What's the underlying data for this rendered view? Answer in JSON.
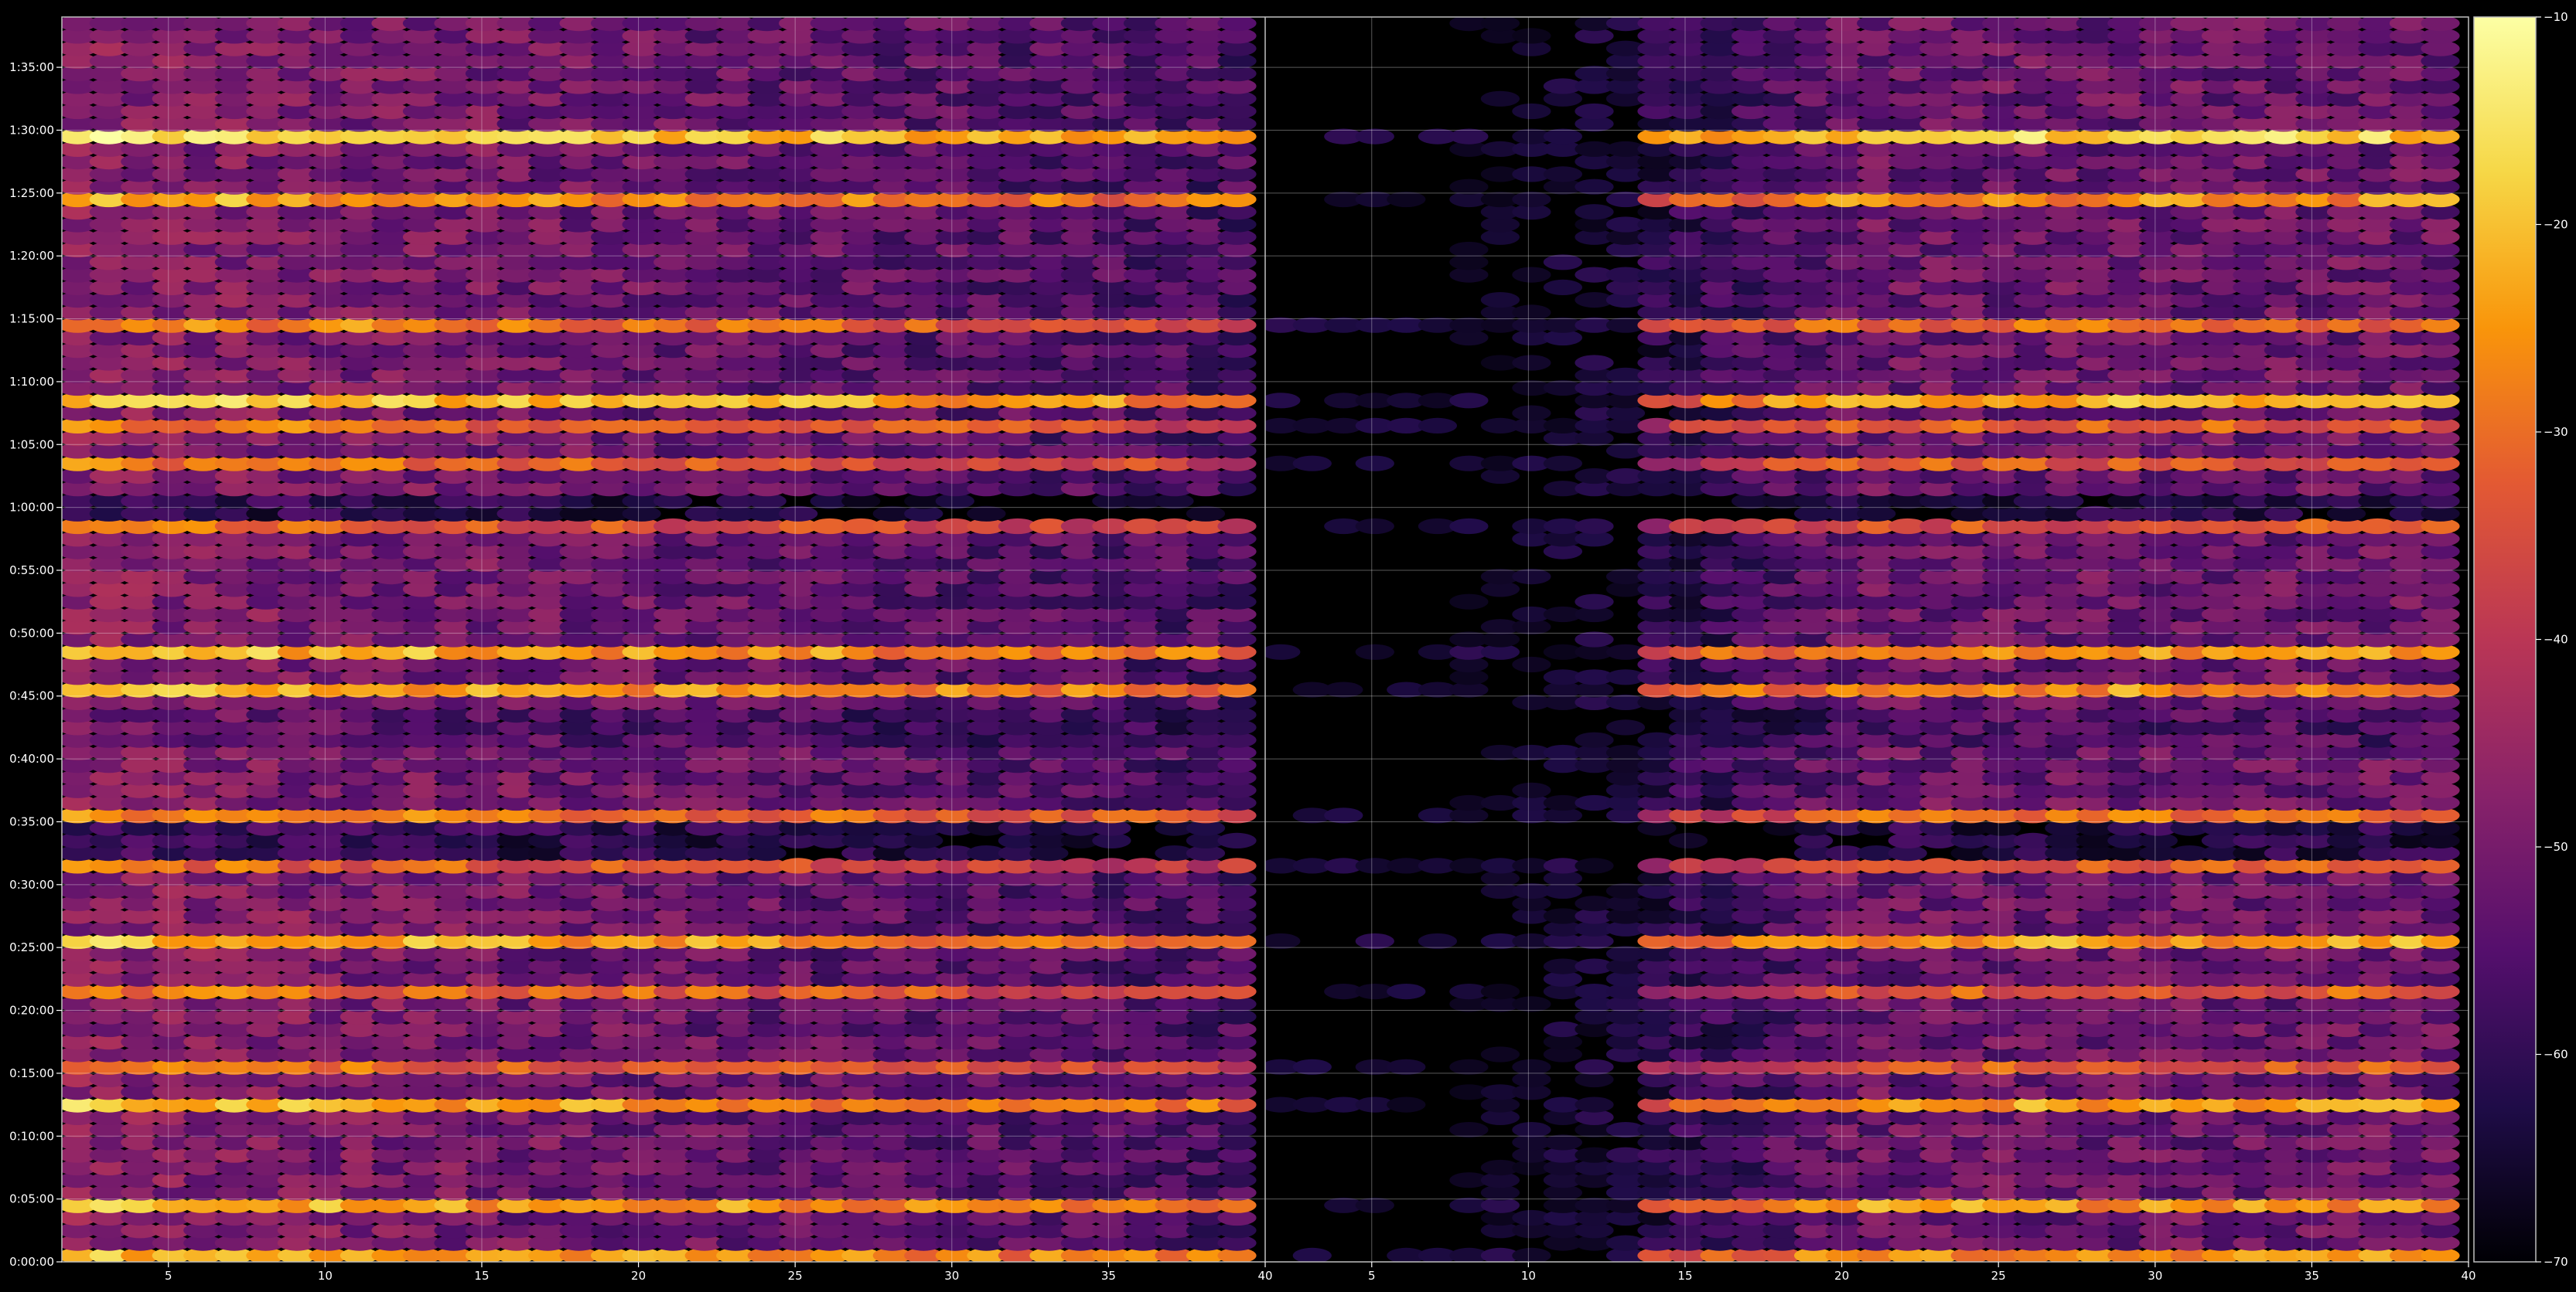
{
  "chart_data": {
    "type": "heatmap",
    "title": "",
    "xlabel": "",
    "ylabel": "",
    "colormap": "inferno",
    "background": "#000000",
    "foreground": "#ffffff",
    "grid": true,
    "panels": [
      {
        "name": "left",
        "xlim": [
          1.6,
          40
        ],
        "active_x_range": [
          1.6,
          39.6
        ],
        "xticks": [
          5,
          10,
          15,
          20,
          25,
          30,
          35,
          40
        ]
      },
      {
        "name": "right",
        "xlim": [
          1.6,
          40
        ],
        "active_x_range": [
          1.6,
          39.6
        ],
        "xticks": [
          5,
          10,
          15,
          20,
          25,
          30,
          35,
          40
        ]
      }
    ],
    "y": {
      "unit": "time",
      "range_seconds": [
        0,
        5940
      ],
      "tick_seconds": [
        0,
        300,
        600,
        900,
        1200,
        1500,
        1800,
        2100,
        2400,
        2700,
        3000,
        3300,
        3600,
        3900,
        4200,
        4500,
        4800,
        5100,
        5400,
        5700
      ],
      "tick_labels": [
        "0:00:00",
        "0:05:00",
        "0:10:00",
        "0:15:00",
        "0:20:00",
        "0:25:00",
        "0:30:00",
        "0:35:00",
        "0:40:00",
        "0:45:00",
        "0:50:00",
        "0:55:00",
        "1:00:00",
        "1:05:00",
        "1:10:00",
        "1:15:00",
        "1:20:00",
        "1:25:00",
        "1:30:00",
        "1:35:00"
      ]
    },
    "colorbar": {
      "range": [
        -70,
        -10
      ],
      "ticks": [
        -70,
        -60,
        -50,
        -40,
        -30,
        -20,
        -10
      ],
      "tick_labels": [
        "−70",
        "−60",
        "−50",
        "−40",
        "−30",
        "−20",
        "−10"
      ]
    },
    "bright_rows_seconds": [
      {
        "t": 5340,
        "level": -18
      },
      {
        "t": 5040,
        "level": -26
      },
      {
        "t": 4440,
        "level": -30
      },
      {
        "t": 4080,
        "level": -22
      },
      {
        "t": 3960,
        "level": -32
      },
      {
        "t": 3780,
        "level": -33
      },
      {
        "t": 3460,
        "level": -32
      },
      {
        "t": 2900,
        "level": -22
      },
      {
        "t": 2700,
        "level": -25
      },
      {
        "t": 2100,
        "level": -30
      },
      {
        "t": 1870,
        "level": -33
      },
      {
        "t": 1500,
        "level": -24
      },
      {
        "t": 1280,
        "level": -30
      },
      {
        "t": 910,
        "level": -32
      },
      {
        "t": 700,
        "level": -22
      },
      {
        "t": 240,
        "level": -25
      },
      {
        "t": 0,
        "level": -25
      }
    ]
  }
}
